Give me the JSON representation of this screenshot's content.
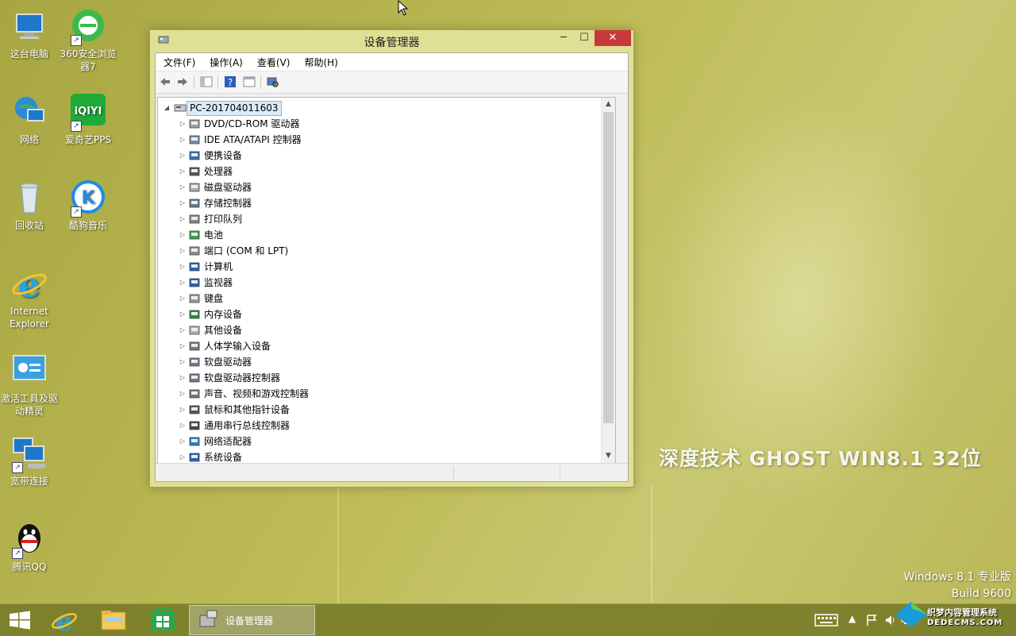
{
  "desktop": {
    "icons": [
      {
        "label": "这台电脑",
        "icon": "computer-icon"
      },
      {
        "label": "360安全浏览器7",
        "icon": "browser-360-icon"
      },
      {
        "label": "网络",
        "icon": "network-globe-icon"
      },
      {
        "label": "爱奇艺PPS",
        "icon": "iqiyi-icon"
      },
      {
        "label": "回收站",
        "icon": "recycle-bin-icon"
      },
      {
        "label": "酷狗音乐",
        "icon": "kugou-icon"
      },
      {
        "label": "Internet Explorer",
        "icon": "ie-icon"
      },
      {
        "label": "激活工具及驱动精灵",
        "icon": "tools-icon"
      },
      {
        "label": "宽带连接",
        "icon": "broadband-icon"
      },
      {
        "label": "腾讯QQ",
        "icon": "qq-icon"
      }
    ],
    "watermark": "深度技术  GHOST  WIN8.1  32位",
    "os_edition": "Windows 8.1 专业版",
    "os_build": "Build 9600"
  },
  "window": {
    "title": "设备管理器",
    "minimize": "─",
    "maximize": "☐",
    "close": "✕",
    "menu": [
      "文件(F)",
      "操作(A)",
      "查看(V)",
      "帮助(H)"
    ],
    "root": "PC-201704011603",
    "devices": [
      {
        "label": "DVD/CD-ROM 驱动器",
        "icon": "dvd-icon"
      },
      {
        "label": "IDE ATA/ATAPI 控制器",
        "icon": "ide-icon"
      },
      {
        "label": "便携设备",
        "icon": "portable-icon"
      },
      {
        "label": "处理器",
        "icon": "processor-icon"
      },
      {
        "label": "磁盘驱动器",
        "icon": "disk-icon"
      },
      {
        "label": "存储控制器",
        "icon": "storage-icon"
      },
      {
        "label": "打印队列",
        "icon": "printer-icon"
      },
      {
        "label": "电池",
        "icon": "battery-icon"
      },
      {
        "label": "端口 (COM 和 LPT)",
        "icon": "port-icon"
      },
      {
        "label": "计算机",
        "icon": "computer-icon"
      },
      {
        "label": "监视器",
        "icon": "monitor-icon"
      },
      {
        "label": "键盘",
        "icon": "keyboard-icon"
      },
      {
        "label": "内存设备",
        "icon": "memory-icon"
      },
      {
        "label": "其他设备",
        "icon": "other-device-icon"
      },
      {
        "label": "人体学输入设备",
        "icon": "hid-icon"
      },
      {
        "label": "软盘驱动器",
        "icon": "floppy-icon"
      },
      {
        "label": "软盘驱动器控制器",
        "icon": "floppy-controller-icon"
      },
      {
        "label": "声音、视频和游戏控制器",
        "icon": "sound-icon"
      },
      {
        "label": "鼠标和其他指针设备",
        "icon": "mouse-icon"
      },
      {
        "label": "通用串行总线控制器",
        "icon": "usb-icon"
      },
      {
        "label": "网络适配器",
        "icon": "network-adapter-icon"
      },
      {
        "label": "系统设备",
        "icon": "system-device-icon"
      }
    ]
  },
  "taskbar": {
    "active_app": "设备管理器",
    "site_logo_line1": "织梦内容管理系统",
    "site_logo_line2": "DEDECMS.COM"
  },
  "colors": {
    "accent_close": "#c7383a",
    "desktop": "#b3b24c",
    "selection": "#dcebf8"
  }
}
